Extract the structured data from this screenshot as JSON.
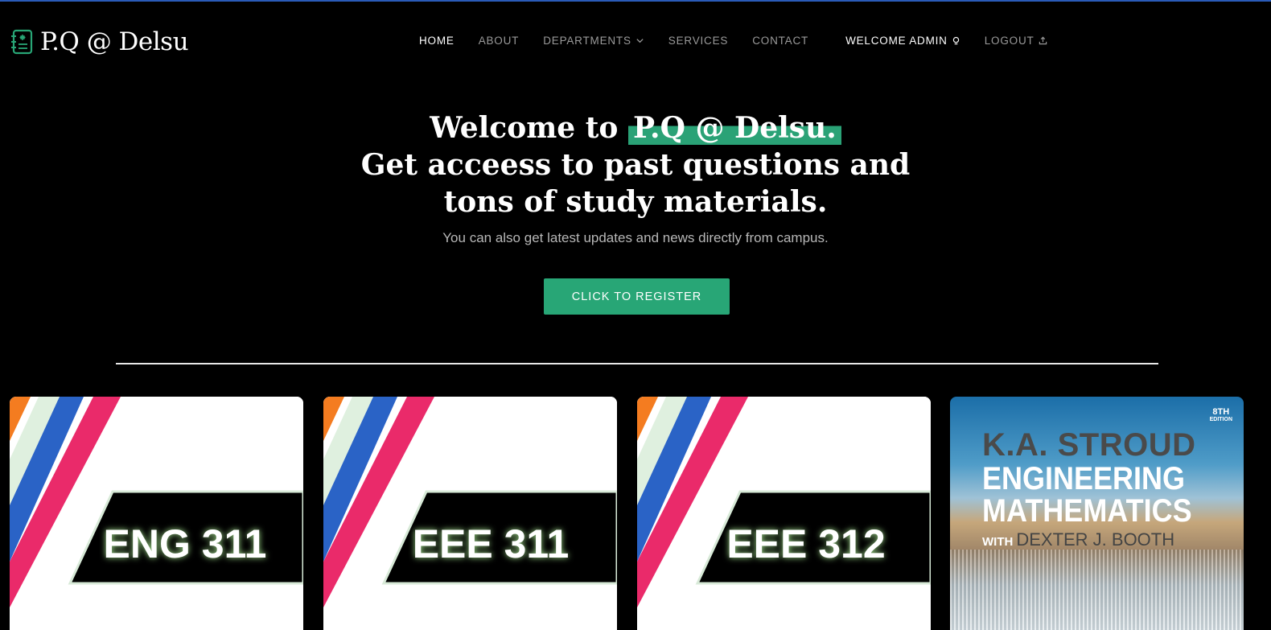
{
  "brand": {
    "name": "P.Q @ Delsu",
    "accent": "#28a676"
  },
  "nav": {
    "home": "HOME",
    "about": "ABOUT",
    "departments": "DEPARTMENTS",
    "services": "SERVICES",
    "contact": "CONTACT",
    "welcome": "WELCOME ADMIN",
    "logout": "LOGOUT"
  },
  "hero": {
    "line1_prefix": "Welcome to",
    "line1_highlight": "P.Q @ Delsu.",
    "line2": "Get acceess to past questions and",
    "line3": "tons of study materials.",
    "subtitle": "You can also get latest updates and news directly from campus.",
    "cta": "CLICK TO REGISTER"
  },
  "cards": [
    {
      "code": "ENG 311"
    },
    {
      "code": "EEE 311"
    },
    {
      "code": "EEE 312"
    },
    {
      "edition_num": "8TH",
      "edition_word": "EDITION",
      "author": "K.A. STROUD",
      "title_1": "ENGINEERING",
      "title_2": "MATHEMATICS",
      "with": "WITH",
      "coauthor": "DEXTER J. BOOTH"
    }
  ]
}
